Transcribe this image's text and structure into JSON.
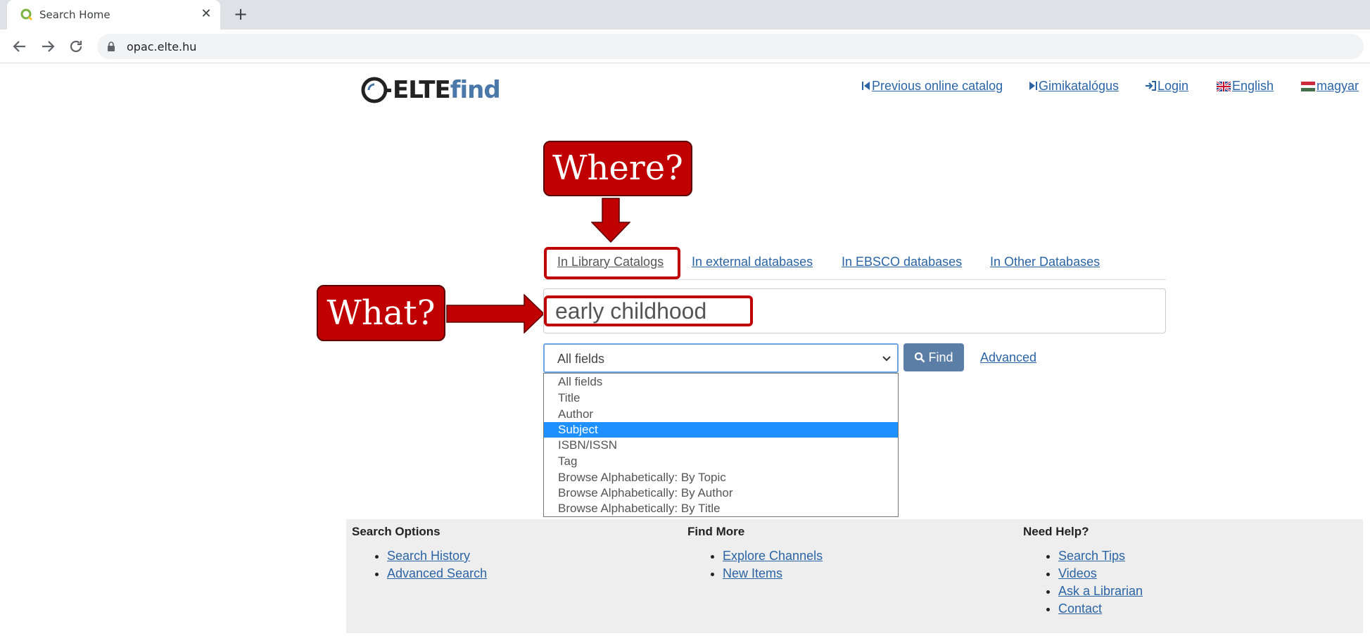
{
  "browser": {
    "tab_title": "Search Home",
    "tab_close": "✕",
    "new_tab": "+",
    "url": "opac.elte.hu"
  },
  "header": {
    "logo_elte": "ELTE",
    "logo_find": "find",
    "nav": [
      {
        "label": "Previous online catalog",
        "icon": "skip-back-icon"
      },
      {
        "label": "Gimikatalógus",
        "icon": "skip-forward-icon"
      },
      {
        "label": "Login",
        "icon": "login-icon"
      },
      {
        "label": "English",
        "icon": "uk-flag-icon"
      },
      {
        "label": "magyar",
        "icon": "hungary-flag-icon"
      }
    ]
  },
  "annotations": {
    "where": "Where?",
    "what": "What?",
    "color": "#c00000"
  },
  "search": {
    "tabs": [
      "In Library Catalogs",
      "In external databases",
      "In EBSCO databases",
      "In Other Databases"
    ],
    "query": "early childhood",
    "field_selected": "All fields",
    "find_label": "Find",
    "advanced_label": "Advanced",
    "options": [
      "All fields",
      "Title",
      "Author",
      "Subject",
      "ISBN/ISSN",
      "Tag",
      "Browse Alphabetically: By Topic",
      "Browse Alphabetically: By Author",
      "Browse Alphabetically: By Title"
    ],
    "highlighted_option": "Subject"
  },
  "footer": {
    "search_options": {
      "title": "Search Options",
      "links": [
        "Search History",
        "Advanced Search"
      ]
    },
    "find_more": {
      "title": "Find More",
      "links": [
        "Explore Channels",
        "New Items"
      ]
    },
    "need_help": {
      "title": "Need Help?",
      "links": [
        "Search Tips",
        "Videos",
        "Ask a Librarian",
        "Contact"
      ]
    }
  },
  "colors": {
    "link": "#2a64a5",
    "find_button": "#5b7ea6",
    "selected_option": "#1e90ff",
    "logo_find": "#4a78a8"
  }
}
